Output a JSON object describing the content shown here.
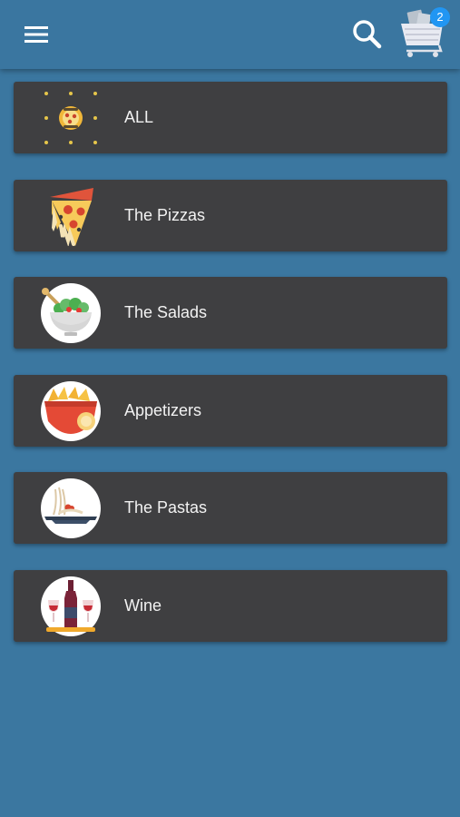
{
  "appbar": {
    "menu_icon": "hamburger-menu-icon",
    "search_icon": "search-icon",
    "cart_icon": "shopping-cart-icon",
    "cart_count": "2",
    "badge_color": "#2196f3",
    "bar_color": "#3a76a0"
  },
  "categories": [
    {
      "label": "ALL",
      "icon": "all-dishes-icon"
    },
    {
      "label": "The Pizzas",
      "icon": "pizza-slice-icon"
    },
    {
      "label": "The Salads",
      "icon": "salad-bowl-icon"
    },
    {
      "label": "Appetizers",
      "icon": "appetizers-basket-icon"
    },
    {
      "label": "The Pastas",
      "icon": "pasta-plate-icon"
    },
    {
      "label": "Wine",
      "icon": "wine-bottle-icon"
    }
  ],
  "colors": {
    "background": "#3b77a0",
    "card": "#3f3f41",
    "card_text": "#f2f2f2"
  }
}
